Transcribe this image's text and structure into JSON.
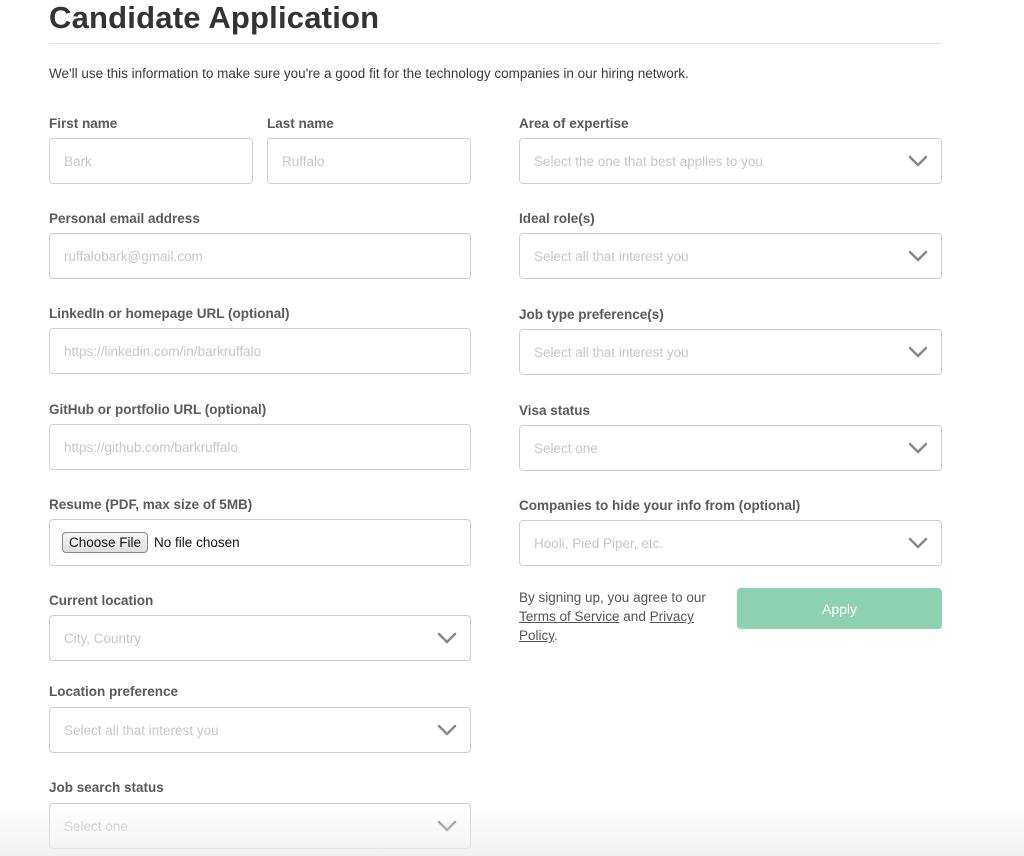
{
  "header": {
    "title": "Candidate Application",
    "intro": "We'll use this information to make sure you're a good fit for the technology companies in our hiring network."
  },
  "left": {
    "first_name": {
      "label": "First name",
      "placeholder": "Bark"
    },
    "last_name": {
      "label": "Last name",
      "placeholder": "Ruffalo"
    },
    "email": {
      "label": "Personal email address",
      "placeholder": "ruffalobark@gmail.com"
    },
    "linkedin": {
      "label": "LinkedIn or homepage URL (optional)",
      "placeholder": "https://linkedin.com/in/barkruffalo"
    },
    "github": {
      "label": "GitHub or portfolio URL (optional)",
      "placeholder": "https://github.com/barkruffalo"
    },
    "resume": {
      "label": "Resume (PDF, max size of 5MB)",
      "button": "Choose File",
      "status": "No file chosen"
    },
    "current_location": {
      "label": "Current location",
      "placeholder": "City, Country"
    },
    "location_preference": {
      "label": "Location preference",
      "placeholder": "Select all that interest you"
    },
    "job_search_status": {
      "label": "Job search status",
      "placeholder": "Select one"
    }
  },
  "right": {
    "expertise": {
      "label": "Area of expertise",
      "placeholder": "Select the one that best applies to you"
    },
    "ideal_roles": {
      "label": "Ideal role(s)",
      "placeholder": "Select all that interest you"
    },
    "job_type": {
      "label": "Job type preference(s)",
      "placeholder": "Select all that interest you"
    },
    "visa": {
      "label": "Visa status",
      "placeholder": "Select one"
    },
    "hide_companies": {
      "label": "Companies to hide your info from (optional)",
      "placeholder": "Hooli, Pied Piper, etc."
    }
  },
  "terms": {
    "prefix": "By signing up, you agree to our",
    "tos_link": "Terms of Service",
    "and": "and",
    "privacy_link_1": "Privacy",
    "privacy_link_2": "Policy",
    "suffix": "."
  },
  "apply_button": {
    "label": "Apply",
    "color": "#8dd1b0"
  },
  "icons": {
    "select_arrow": "chevron-down-icon"
  }
}
